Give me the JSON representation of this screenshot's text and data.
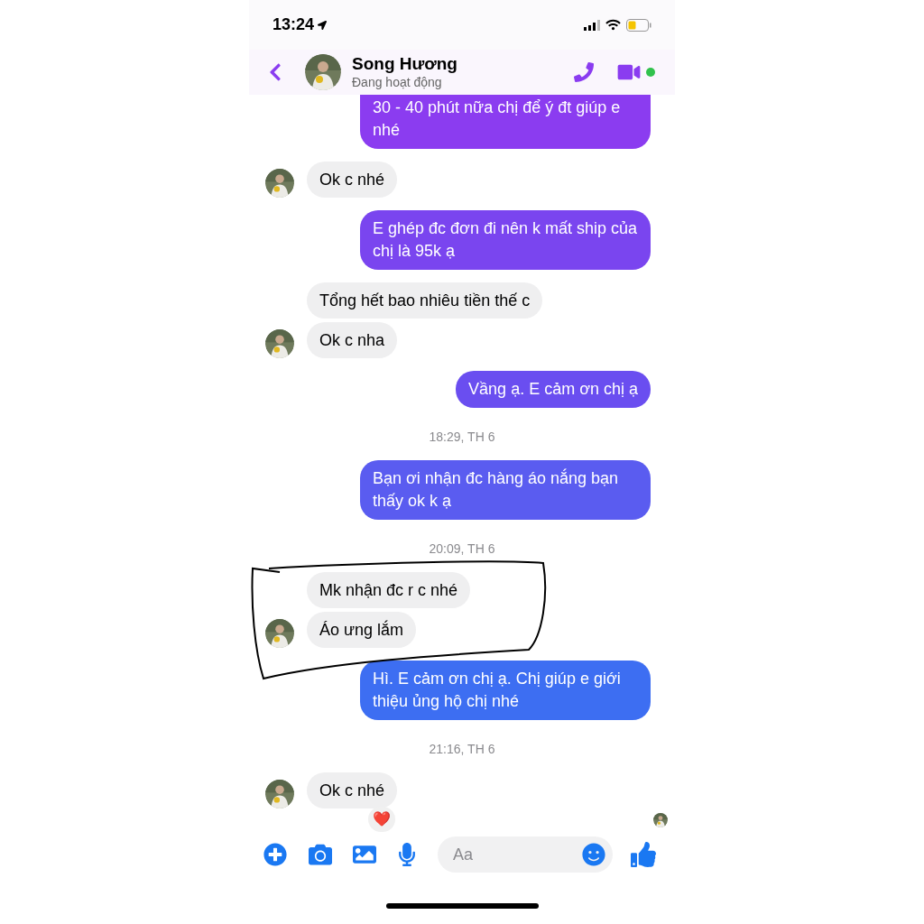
{
  "status_bar": {
    "time": "13:24"
  },
  "header": {
    "name": "Song Hương",
    "status": "Đang hoạt động",
    "online": true
  },
  "messages": [
    {
      "kind": "outgoing",
      "text": "30 - 40 phút nữa chị để ý đt giúp e nhé",
      "cut_off": true
    },
    {
      "kind": "incoming",
      "text": "Ok c nhé",
      "avatar": true
    },
    {
      "kind": "outgoing",
      "text": "E ghép đc đơn đi nên k mất ship của chị là 95k ạ"
    },
    {
      "kind": "incoming",
      "text": "Tổng hết bao nhiêu tiền thế c",
      "avatar": false
    },
    {
      "kind": "incoming",
      "text": "Ok c nha",
      "avatar": true
    },
    {
      "kind": "outgoing",
      "text": "Vầng ạ. E cảm ơn chị ạ"
    },
    {
      "kind": "time",
      "text": "18:29, TH 6"
    },
    {
      "kind": "outgoing",
      "text": "Bạn ơi nhận đc hàng áo nắng bạn thấy ok k ạ"
    },
    {
      "kind": "time",
      "text": "20:09, TH 6"
    },
    {
      "kind": "incoming",
      "text": "Mk nhận đc r c nhé",
      "avatar": false
    },
    {
      "kind": "incoming",
      "text": "Áo ưng lắm",
      "avatar": true
    },
    {
      "kind": "outgoing",
      "text": "Hì. E cảm ơn chị ạ. Chị giúp e giới thiệu ủng hộ chị nhé"
    },
    {
      "kind": "time",
      "text": "21:16, TH 6"
    },
    {
      "kind": "incoming",
      "text": "Ok c nhé",
      "avatar": true,
      "reaction": "❤️"
    }
  ],
  "composer": {
    "placeholder": "Aa"
  }
}
